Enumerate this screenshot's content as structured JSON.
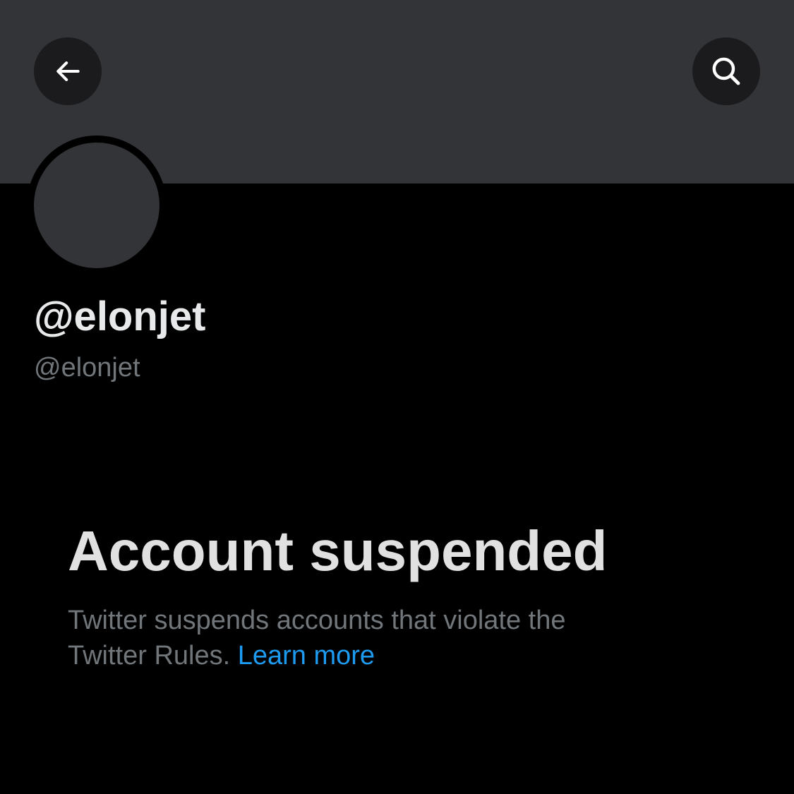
{
  "header": {
    "back_icon": "arrow-left-icon",
    "search_icon": "search-icon",
    "banner_color": "#333438"
  },
  "profile": {
    "display_name": "@elonjet",
    "handle": "@elonjet",
    "avatar_color": "#333438"
  },
  "suspension": {
    "title": "Account suspended",
    "body_line1": "Twitter suspends accounts that violate the",
    "body_line2": "Twitter Rules.",
    "link_label": "Learn more",
    "link_color": "#1d9bf0"
  }
}
